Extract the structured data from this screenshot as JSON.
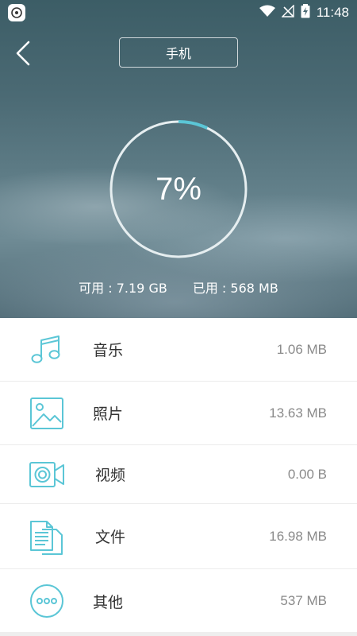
{
  "status_bar": {
    "time": "11:48"
  },
  "header": {
    "back_icon": "chevron-left-icon",
    "device_tab_label": "手机"
  },
  "storage": {
    "used_fraction": 0.07,
    "percent_text": "7%",
    "available_text": "可用 : 7.19 GB",
    "used_text": "已用 : 568 MB"
  },
  "categories": [
    {
      "label": "音乐",
      "size": "1.06 MB",
      "icon": "music-note-icon"
    },
    {
      "label": "照片",
      "size": "13.63 MB",
      "icon": "photo-icon"
    },
    {
      "label": "视频",
      "size": "0.00 B",
      "icon": "video-camera-icon"
    },
    {
      "label": "文件",
      "size": "16.98 MB",
      "icon": "documents-icon"
    },
    {
      "label": "其他",
      "size": "537 MB",
      "icon": "more-icon"
    }
  ],
  "colors": {
    "accent": "#5bc6d6",
    "ring": "#e6eef0"
  }
}
